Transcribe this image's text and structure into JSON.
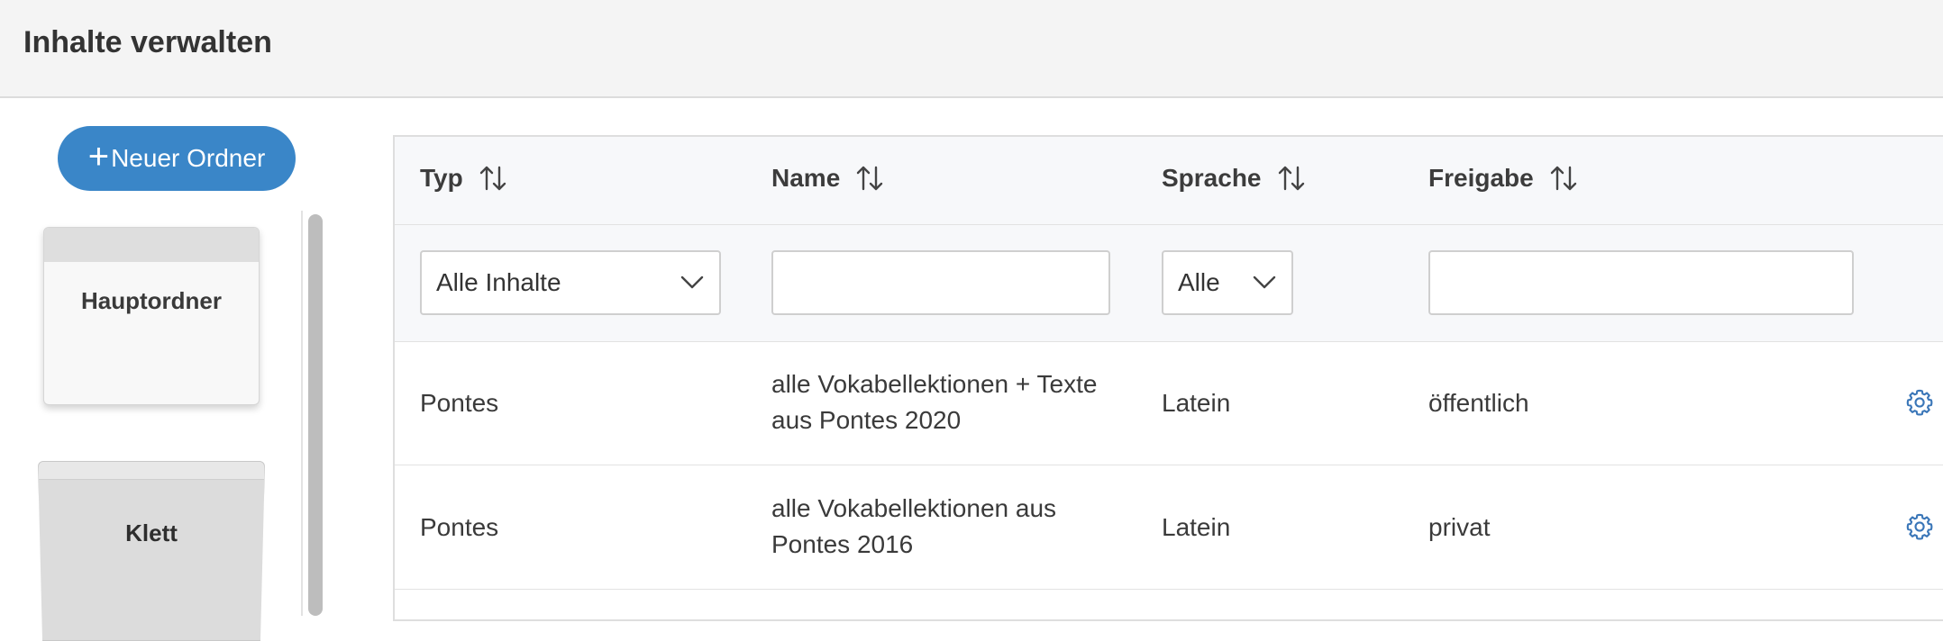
{
  "header": {
    "title": "Inhalte verwalten"
  },
  "sidebar": {
    "new_folder_button": {
      "icon": "plus-icon",
      "label": "Neuer Ordner"
    },
    "folders": [
      {
        "label": "Hauptordner"
      },
      {
        "label": "Klett"
      }
    ]
  },
  "table": {
    "columns": [
      {
        "label": "Typ",
        "sort_icon": "sort-icon"
      },
      {
        "label": "Name",
        "sort_icon": "sort-icon"
      },
      {
        "label": "Sprache",
        "sort_icon": "sort-icon"
      },
      {
        "label": "Freigabe",
        "sort_icon": "sort-icon"
      }
    ],
    "filters": {
      "typ_select": {
        "value": "Alle Inhalte"
      },
      "name_input": {
        "value": ""
      },
      "sprache_select": {
        "value": "Alle"
      },
      "freigabe_input": {
        "value": ""
      }
    },
    "rows": [
      {
        "typ": "Pontes",
        "name_line1": "alle Vokabellektionen + Texte",
        "name_line2": "aus Pontes 2020",
        "sprache": "Latein",
        "freigabe": "öffentlich",
        "action_icon": "gear-icon"
      },
      {
        "typ": "Pontes",
        "name_line1": "alle Vokabellektionen aus",
        "name_line2": "Pontes 2016",
        "sprache": "Latein",
        "freigabe": "privat",
        "action_icon": "gear-icon"
      }
    ]
  },
  "colors": {
    "accent": "#3a86c8",
    "gear": "#3a76b8",
    "header_bg": "#f4f4f4",
    "table_header_bg": "#f7f8fa"
  }
}
